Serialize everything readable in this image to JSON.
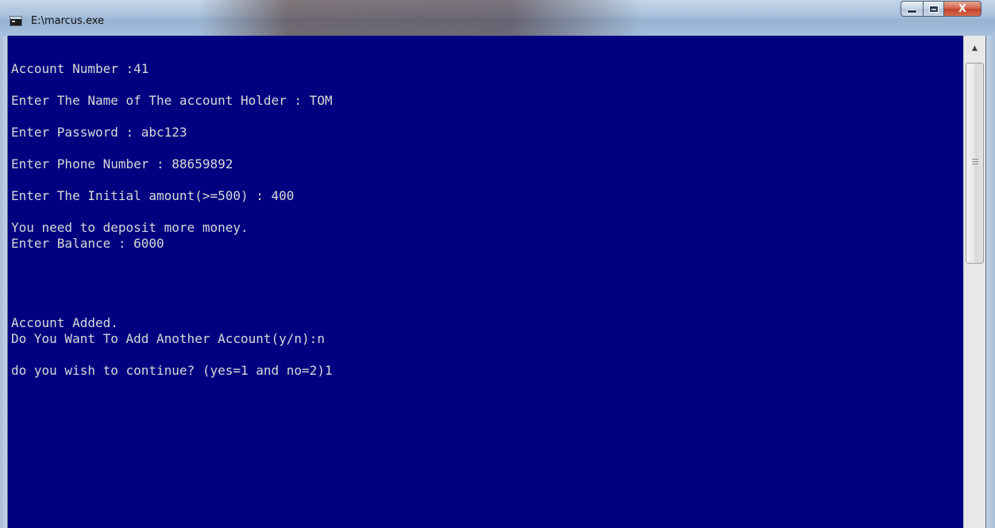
{
  "window": {
    "title": "E:\\marcus.exe",
    "icon": "console-app-icon",
    "controls": {
      "minimize": "minimize-icon",
      "maximize": "maximize-icon",
      "close_label": "X"
    }
  },
  "console": {
    "background": "#000080",
    "foreground": "#d8d8d8",
    "lines": [
      "Account Number :41",
      "",
      "Enter The Name of The account Holder : TOM",
      "",
      "Enter Password : abc123",
      "",
      "Enter Phone Number : 88659892",
      "",
      "Enter The Initial amount(>=500) : 400",
      "",
      "You need to deposit more money.",
      "Enter Balance : 6000",
      "",
      "",
      "",
      "",
      "Account Added.",
      "Do You Want To Add Another Account(y/n):n",
      "",
      "do you wish to continue? (yes=1 and no=2)1"
    ]
  },
  "scrollbar": {
    "up_arrow": "▲"
  }
}
